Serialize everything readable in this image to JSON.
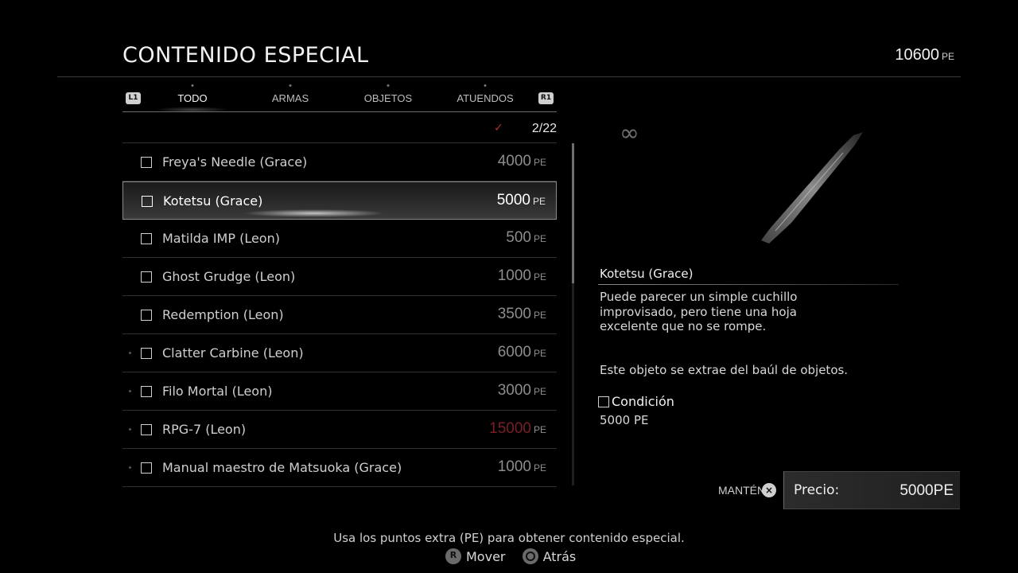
{
  "header": {
    "title": "CONTENIDO ESPECIAL",
    "points_value": "10600",
    "points_unit": "PE"
  },
  "tabs": {
    "left_shoulder": "L1",
    "right_shoulder": "R1",
    "items": [
      {
        "label": "TODO",
        "active": true
      },
      {
        "label": "ARMAS",
        "active": false
      },
      {
        "label": "OBJETOS",
        "active": false
      },
      {
        "label": "ATUENDOS",
        "active": false
      }
    ]
  },
  "counter": "2/22",
  "items": [
    {
      "name": "Freya's Needle (Grace)",
      "price": "4000",
      "unit": "PE"
    },
    {
      "name": "Kotetsu (Grace)",
      "price": "5000",
      "unit": "PE",
      "selected": true
    },
    {
      "name": "Matilda IMP (Leon)",
      "price": "500",
      "unit": "PE"
    },
    {
      "name": "Ghost Grudge (Leon)",
      "price": "1000",
      "unit": "PE"
    },
    {
      "name": "Redemption (Leon)",
      "price": "3500",
      "unit": "PE"
    },
    {
      "name": "Clatter Carbine (Leon)",
      "price": "6000",
      "unit": "PE"
    },
    {
      "name": "Filo Mortal (Leon)",
      "price": "3000",
      "unit": "PE"
    },
    {
      "name": "RPG-7 (Leon)",
      "price": "15000",
      "unit": "PE",
      "unaffordable": true
    },
    {
      "name": "Manual maestro de Matsuoka (Grace)",
      "price": "1000",
      "unit": "PE"
    }
  ],
  "detail": {
    "infinity_symbol": "∞",
    "name": "Kotetsu (Grace)",
    "description": "Puede parecer un simple cuchillo improvisado, pero tiene una hoja excelente que no se rompe.",
    "source": "Este objeto se extrae del baúl de objetos.",
    "condition_label": "Condición",
    "condition_value": "5000 PE"
  },
  "purchase": {
    "hold_label": "MANTÉN",
    "hold_button": "×",
    "price_label": "Precio:",
    "price_value": "5000",
    "price_unit": "PE"
  },
  "footer": {
    "hint": "Usa los puntos extra (PE) para obtener contenido especial.",
    "move_label": "Mover",
    "back_label": "Atrás"
  },
  "colors": {
    "unaffordable_price": "#7a1f26",
    "check": "#b03030"
  }
}
